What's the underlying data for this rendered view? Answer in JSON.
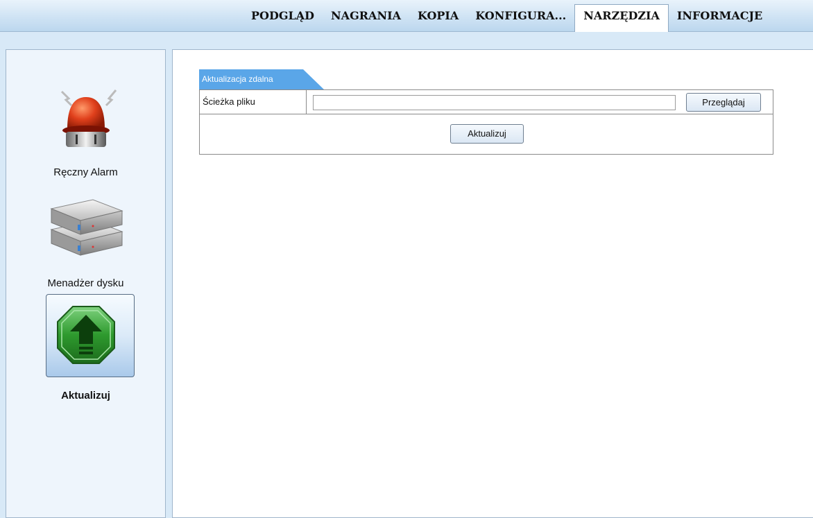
{
  "nav": {
    "tabs": [
      {
        "label": "PODGLĄD"
      },
      {
        "label": "NAGRANIA"
      },
      {
        "label": "KOPIA"
      },
      {
        "label": "KONFIGURA..."
      },
      {
        "label": "NARZĘDZIA",
        "active": true
      },
      {
        "label": "INFORMACJE"
      }
    ]
  },
  "sidebar": {
    "items": [
      {
        "label": "Ręczny Alarm",
        "icon": "alarm-beacon-icon"
      },
      {
        "label": "Menadżer dysku",
        "icon": "hard-disk-icon"
      },
      {
        "label": "Aktualizuj",
        "icon": "upgrade-arrow-icon",
        "selected": true
      }
    ]
  },
  "panel": {
    "tab_title": "Aktualizacja zdalna",
    "file_path_label": "Ścieżka pliku",
    "file_path_value": "",
    "browse_label": "Przeglądaj",
    "update_label": "Aktualizuj"
  },
  "colors": {
    "accent_tab": "#5aa6e8",
    "nav_bg": "#cfe3f4",
    "sidebar_bg": "#eef5fc",
    "upgrade_green": "#2e8b2e"
  }
}
